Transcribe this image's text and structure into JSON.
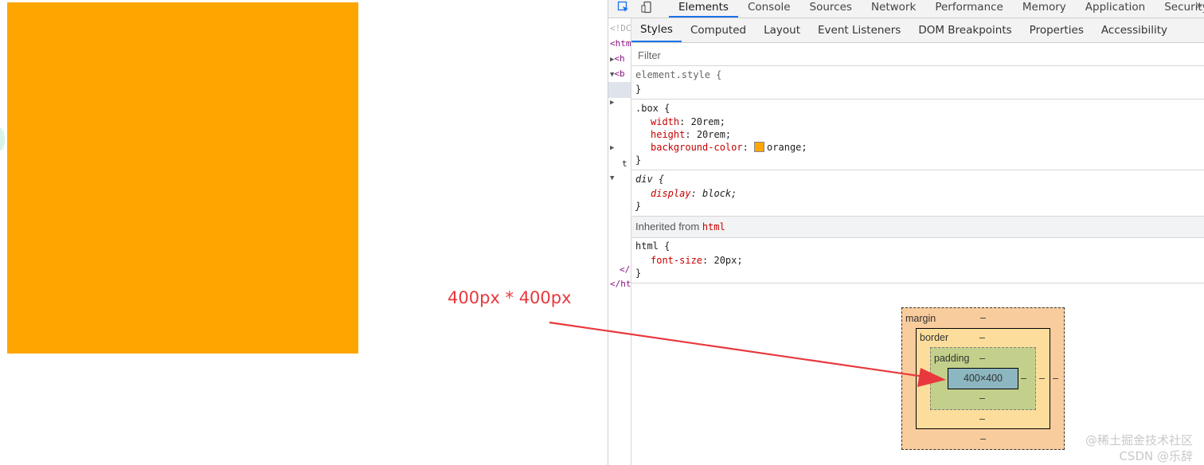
{
  "page": {
    "box_color": "#ffa500",
    "annotation": "400px * 400px",
    "annotation_color": "#e8383d"
  },
  "devtools": {
    "toolbar_icons": [
      "inspect-element-icon",
      "device-toggle-icon"
    ],
    "main_tabs": [
      "Elements",
      "Console",
      "Sources",
      "Network",
      "Performance",
      "Memory",
      "Application",
      "Security"
    ],
    "active_main_tab": "Elements",
    "more_tabs_glyph": "»",
    "dom_gutter": [
      "<!DC",
      "<htm",
      "<h",
      "<b",
      "t",
      "</",
      "</ht"
    ],
    "sub_tabs": [
      "Styles",
      "Computed",
      "Layout",
      "Event Listeners",
      "DOM Breakpoints",
      "Properties",
      "Accessibility"
    ],
    "active_sub_tab": "Styles",
    "filter_placeholder": "Filter",
    "rules": {
      "element_style": {
        "selector": "element.style {",
        "close": "}"
      },
      "box": {
        "selector": ".box {",
        "decls": [
          {
            "prop": "width",
            "value": "20rem;"
          },
          {
            "prop": "height",
            "value": "20rem;"
          },
          {
            "prop": "background-color",
            "value": "orange;"
          }
        ],
        "close": "}"
      },
      "div": {
        "selector": "div {",
        "decls": [
          {
            "prop": "display",
            "value": "block;"
          }
        ],
        "close": "}"
      },
      "inherited": {
        "label": "Inherited from",
        "tag": "html"
      },
      "html": {
        "selector": "html {",
        "decls": [
          {
            "prop": "font-size",
            "value": "20px;"
          }
        ],
        "close": "}"
      }
    },
    "box_model": {
      "margin_label": "margin",
      "border_label": "border",
      "padding_label": "padding",
      "content_size": "400×400",
      "dash": "–"
    }
  },
  "watermark": {
    "line1": "@稀土掘金技术社区",
    "line2": "CSDN @乐辞"
  }
}
